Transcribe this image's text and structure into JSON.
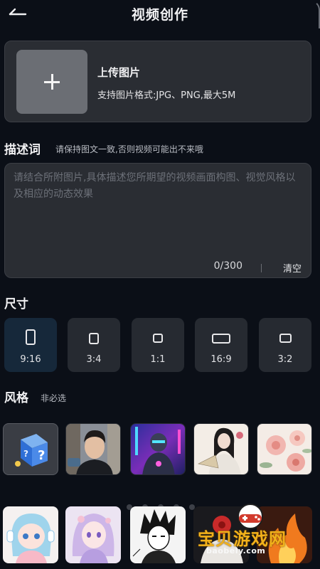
{
  "header": {
    "title": "视频创作"
  },
  "upload": {
    "title": "上传图片",
    "hint": "支持图片格式:JPG、PNG,最大5M"
  },
  "description": {
    "label": "描述词",
    "sub": "请保持图文一致,否则视频可能出不来哦",
    "placeholder": "请结合所附图片,具体描述您所期望的视频画面构图、视觉风格以及相应的动态效果",
    "value": "",
    "counter": "0/300",
    "clear_label": "清空"
  },
  "size": {
    "label": "尺寸",
    "options": [
      {
        "label": "9:16",
        "selected": true
      },
      {
        "label": "3:4",
        "selected": false
      },
      {
        "label": "1:1",
        "selected": false
      },
      {
        "label": "16:9",
        "selected": false
      },
      {
        "label": "3:2",
        "selected": false
      }
    ]
  },
  "style": {
    "label": "风格",
    "sub": "非必选",
    "row1": [
      "random-box-icon",
      "young-man-portrait",
      "cyberpunk-robot",
      "ink-painting-lady",
      "pink-flowers"
    ],
    "row2": [
      "chibi-girl-headphones",
      "anime-girl-purple",
      "manga-sketch-boy",
      "flower-portrait",
      "fire-figure"
    ]
  },
  "watermark": {
    "text": "宝贝游戏网",
    "url": "baobeiy.com"
  },
  "colors": {
    "background": "#0b0f17",
    "card": "#2a2d33",
    "selected_size": "#16283a",
    "watermark": "#f2b11b"
  }
}
